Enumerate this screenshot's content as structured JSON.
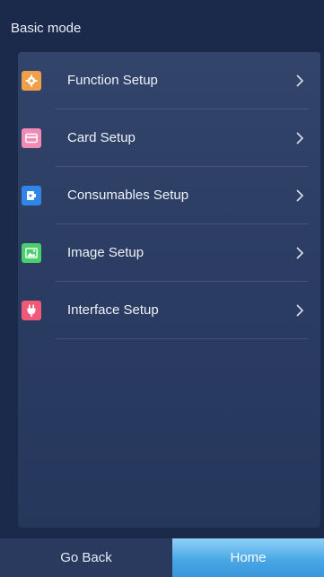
{
  "header": {
    "title": "Basic mode"
  },
  "menu": {
    "items": [
      {
        "label": "Function Setup",
        "icon": "gear-icon",
        "icon_color": "#f0a04b"
      },
      {
        "label": "Card Setup",
        "icon": "card-icon",
        "icon_color": "#f08bb6"
      },
      {
        "label": "Consumables Setup",
        "icon": "ribbon-icon",
        "icon_color": "#2f86e8"
      },
      {
        "label": "Image Setup",
        "icon": "image-icon",
        "icon_color": "#4ad06b"
      },
      {
        "label": "Interface Setup",
        "icon": "plug-icon",
        "icon_color": "#f05a78"
      }
    ]
  },
  "footer": {
    "back_label": "Go Back",
    "home_label": "Home"
  },
  "colors": {
    "background": "#1b2a4b",
    "panel": "#2e4066",
    "home_button": "#4aa8e6",
    "back_button": "#2a3a5f"
  }
}
